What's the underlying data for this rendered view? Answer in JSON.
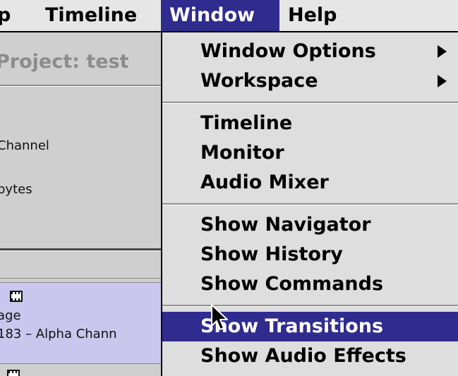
{
  "menubar": {
    "items": [
      "p",
      "Timeline",
      "Window",
      "Help"
    ],
    "active": "Window"
  },
  "panel": {
    "title": "Project: test",
    "info_lines": [
      "Channel",
      "bytes"
    ],
    "clip": {
      "line1": ":",
      "line2": "age",
      "line3": "183 – Alpha Chann"
    }
  },
  "window_menu": {
    "window_options": "Window Options",
    "workspace": "Workspace",
    "timeline": "Timeline",
    "monitor": "Monitor",
    "audio_mixer": "Audio Mixer",
    "show_navigator": "Show Navigator",
    "show_history": "Show History",
    "show_commands": "Show Commands",
    "show_transitions": "Show Transitions",
    "show_audio_effects": "Show Audio Effects"
  },
  "colors": {
    "highlight": "#2f2b8f",
    "menu_bg": "#dedede",
    "clip_bg": "#c9c7ee"
  },
  "icons": [
    "submenu-arrow-icon",
    "film-clip-icon",
    "mouse-pointer-icon"
  ]
}
